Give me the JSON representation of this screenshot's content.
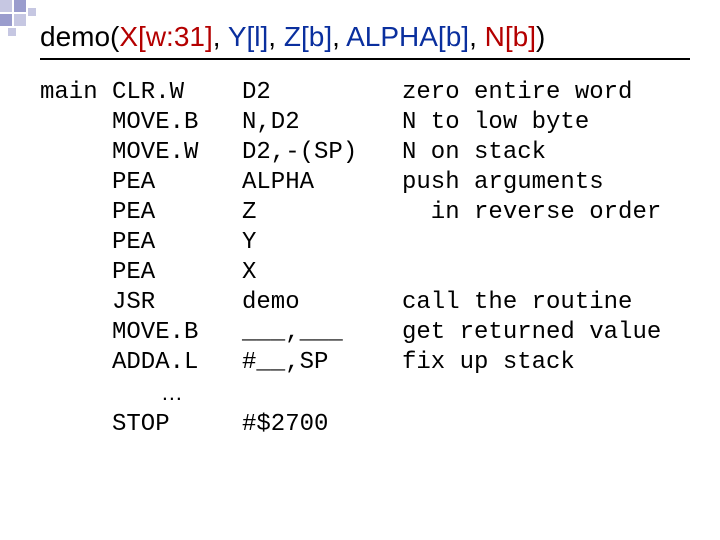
{
  "title": {
    "prefix": "demo(",
    "params": [
      {
        "text": "X[w:31]",
        "cls": "p-x"
      },
      {
        "text": "Y[l]",
        "cls": "p-y"
      },
      {
        "text": "Z[b]",
        "cls": "p-z"
      },
      {
        "text": "ALPHA[b]",
        "cls": "p-alpha"
      },
      {
        "text": "N[b]",
        "cls": "p-n"
      }
    ],
    "sep": ", ",
    "suffix": ")"
  },
  "rows": [
    {
      "label": "main",
      "op": "CLR.W",
      "arg": "D2",
      "cmt": "zero entire word"
    },
    {
      "label": "",
      "op": "MOVE.B",
      "arg": "N,D2",
      "cmt": "N to low byte"
    },
    {
      "label": "",
      "op": "MOVE.W",
      "arg": "D2,-(SP)",
      "cmt": "N on stack"
    },
    {
      "label": "",
      "op": "PEA",
      "arg": "ALPHA",
      "cmt": "push arguments"
    },
    {
      "label": "",
      "op": "PEA",
      "arg": "Z",
      "cmt": "  in reverse order"
    },
    {
      "label": "",
      "op": "PEA",
      "arg": "Y",
      "cmt": ""
    },
    {
      "label": "",
      "op": "PEA",
      "arg": "X",
      "cmt": ""
    },
    {
      "label": "",
      "op": "JSR",
      "arg": "demo",
      "cmt": "call the routine"
    },
    {
      "label": "",
      "op": "MOVE.B",
      "arg": "___,___",
      "cmt": "get returned value"
    },
    {
      "label": "",
      "op": "ADDA.L",
      "arg": "#__,SP",
      "cmt": "fix up stack"
    },
    {
      "label": "",
      "op": "",
      "arg": "",
      "cmt": "",
      "ellipsis": "…"
    },
    {
      "label": "",
      "op": "STOP",
      "arg": "#$2700",
      "cmt": ""
    }
  ]
}
